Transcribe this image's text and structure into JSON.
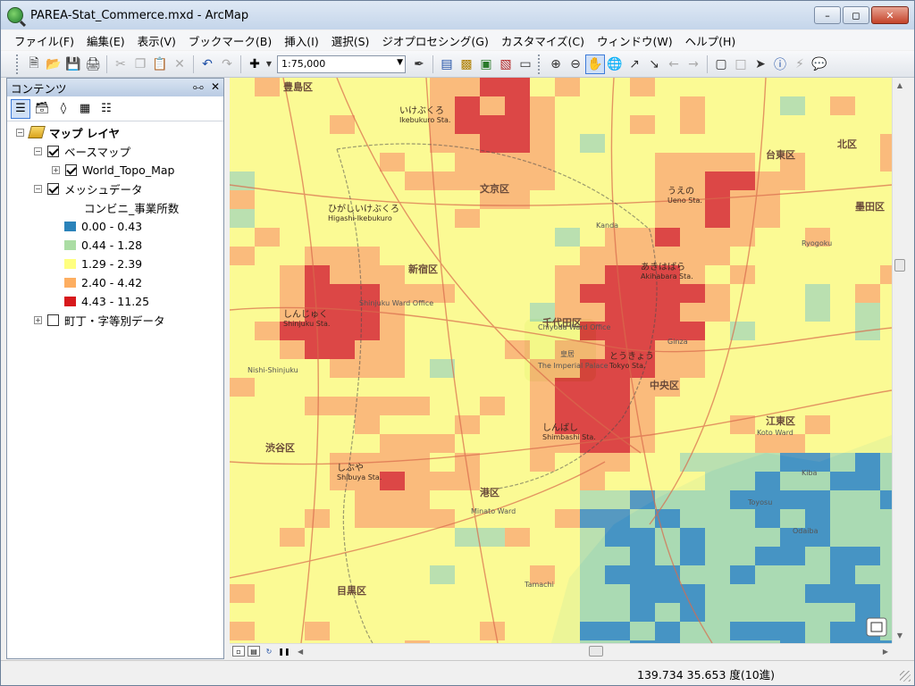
{
  "window": {
    "title": "PAREA-Stat_Commerce.mxd - ArcMap"
  },
  "menu": [
    "ファイル(F)",
    "編集(E)",
    "表示(V)",
    "ブックマーク(B)",
    "挿入(I)",
    "選択(S)",
    "ジオプロセシング(G)",
    "カスタマイズ(C)",
    "ウィンドウ(W)",
    "ヘルプ(H)"
  ],
  "toolbar": {
    "scale": "1:75,000"
  },
  "toc": {
    "title": "コンテンツ",
    "root": "マップ レイヤ",
    "basemap_group": "ベースマップ",
    "basemap_layer": "World_Topo_Map",
    "mesh_group": "メッシュデータ",
    "mesh_field": "コンビニ_事業所数",
    "legend": [
      {
        "label": "0.00 - 0.43",
        "color": "#2b83ba"
      },
      {
        "label": "0.44 - 1.28",
        "color": "#abdda4"
      },
      {
        "label": "1.29 - 2.39",
        "color": "#ffff80"
      },
      {
        "label": "2.40 - 4.42",
        "color": "#fdae61"
      },
      {
        "label": "4.43 - 11.25",
        "color": "#d7191c"
      }
    ],
    "town_layer": "町丁・字等別データ"
  },
  "map": {
    "wards": [
      "豊島区",
      "北区",
      "文京区",
      "台東区",
      "新宿区",
      "千代田区",
      "中央区",
      "港区",
      "渋谷区",
      "墨田区",
      "江東区",
      "目黒区"
    ],
    "stations": [
      {
        "ja": "いけぶくろ",
        "en": "Ikebukuro Sta."
      },
      {
        "ja": "しんじゅく",
        "en": "Shinjuku Sta."
      },
      {
        "ja": "しぶや",
        "en": "Shibuya Sta."
      },
      {
        "ja": "とうきょう",
        "en": "Tokyo Sta."
      },
      {
        "ja": "あきはばら",
        "en": "Akihabara Sta."
      },
      {
        "ja": "しんばし",
        "en": "Shimbashi Sta."
      },
      {
        "ja": "ひがしいけぶくろ",
        "en": "Higashi-Ikebukuro"
      },
      {
        "ja": "うえの",
        "en": "Ueno Sta."
      }
    ],
    "misc_labels": [
      "The Imperial Palace",
      "皇居",
      "Chiyoda Ward Office",
      "Shinjuku Ward Office",
      "Minato Ward",
      "Kanda",
      "Ginza",
      "Tamachi",
      "Koto Ward",
      "Odaiba",
      "Toyosu",
      "Kiba",
      "Ryogoku",
      "Nishi-Shinjuku"
    ]
  },
  "status": {
    "coords": "139.734  35.653 度(10進)"
  }
}
